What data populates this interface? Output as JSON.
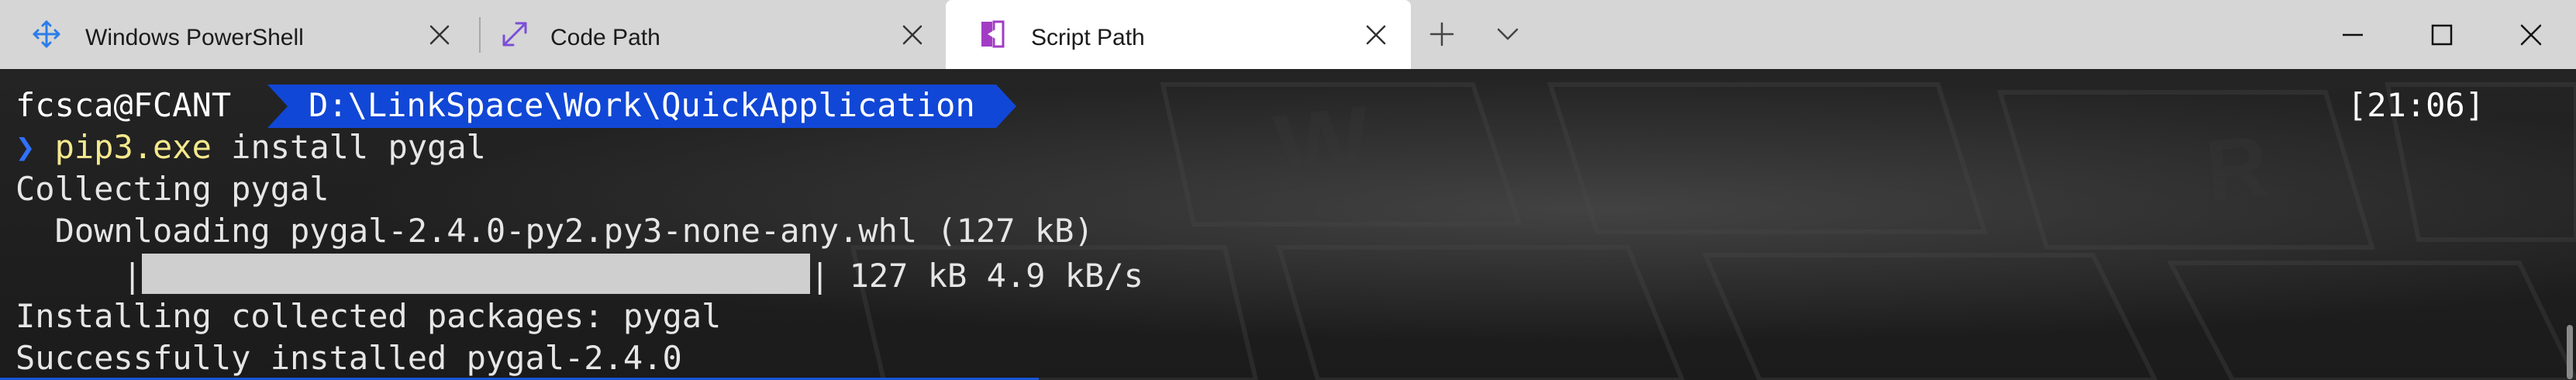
{
  "tabs": [
    {
      "title": "Windows PowerShell",
      "icon": "move-arrows-icon",
      "active": false
    },
    {
      "title": "Code Path",
      "icon": "expand-arrows-icon",
      "active": false
    },
    {
      "title": "Script Path",
      "icon": "split-door-icon",
      "active": true
    }
  ],
  "tabbar": {
    "new_tab_icon": "plus-icon",
    "dropdown_icon": "chevron-down-icon"
  },
  "window_controls": {
    "minimize_icon": "minimize-icon",
    "maximize_icon": "maximize-icon",
    "close_icon": "close-icon"
  },
  "terminal": {
    "prompt_user": "fcsca@FCANT",
    "prompt_path": "D:\\LinkSpace\\Work\\QuickApplication",
    "prompt_time": "[21:06]",
    "prompt_symbol": "❯",
    "command_exe": "pip3.exe",
    "command_args": " install pygal",
    "lines": {
      "collecting": "Collecting pygal",
      "downloading": "  Downloading pygal-2.4.0-py2.py3-none-any.whl (127 kB)",
      "progress_left": "|",
      "progress_right": "| 127 kB 4.9 kB/s",
      "installing": "Installing collected packages: pygal",
      "success": "Successfully installed pygal-2.4.0"
    },
    "download_progress": 1.0
  },
  "colors": {
    "tabbar_bg": "#d6d6d6",
    "active_tab_bg": "#ffffff",
    "path_segment_bg": "#1147d6",
    "prompt_chevron": "#2f71ff",
    "command_color": "#f4e98c",
    "terminal_text": "#e6e6e6"
  }
}
